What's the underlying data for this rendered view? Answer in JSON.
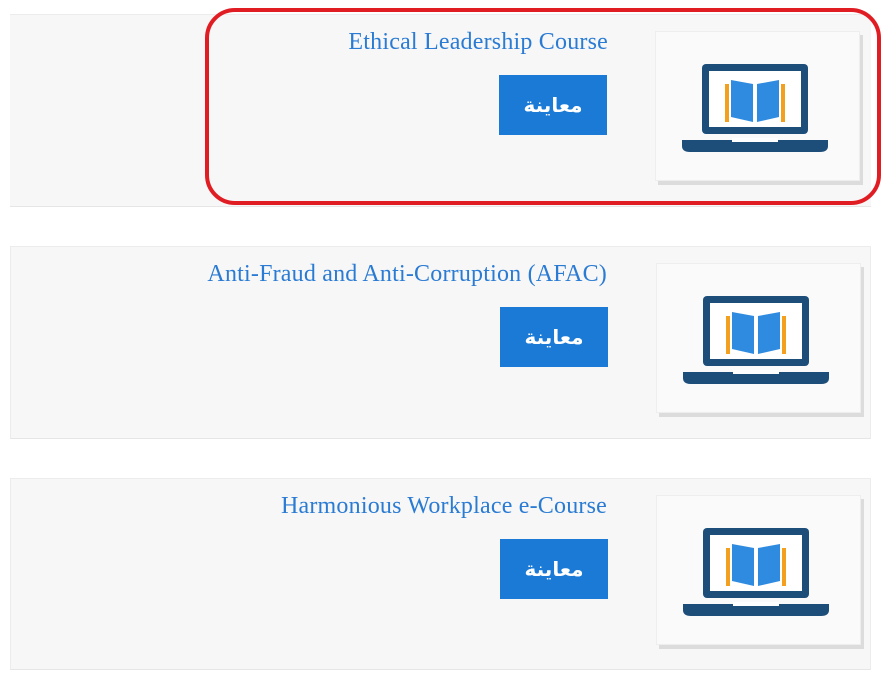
{
  "courses": [
    {
      "title": "Ethical Leadership Course",
      "button_label": "معاينة",
      "icon": "laptop-book-icon"
    },
    {
      "title": "Anti-Fraud and Anti-Corruption (AFAC)",
      "button_label": "معاينة",
      "icon": "laptop-book-icon"
    },
    {
      "title": "Harmonious Workplace e-Course",
      "button_label": "معاينة",
      "icon": "laptop-book-icon"
    }
  ],
  "colors": {
    "title": "#2a7bd3",
    "button": "#1a7ad6",
    "highlight": "#e11d24",
    "icon_dark": "#1d4e7a",
    "icon_blue": "#2f8be0",
    "icon_orange": "#f3a01f"
  }
}
